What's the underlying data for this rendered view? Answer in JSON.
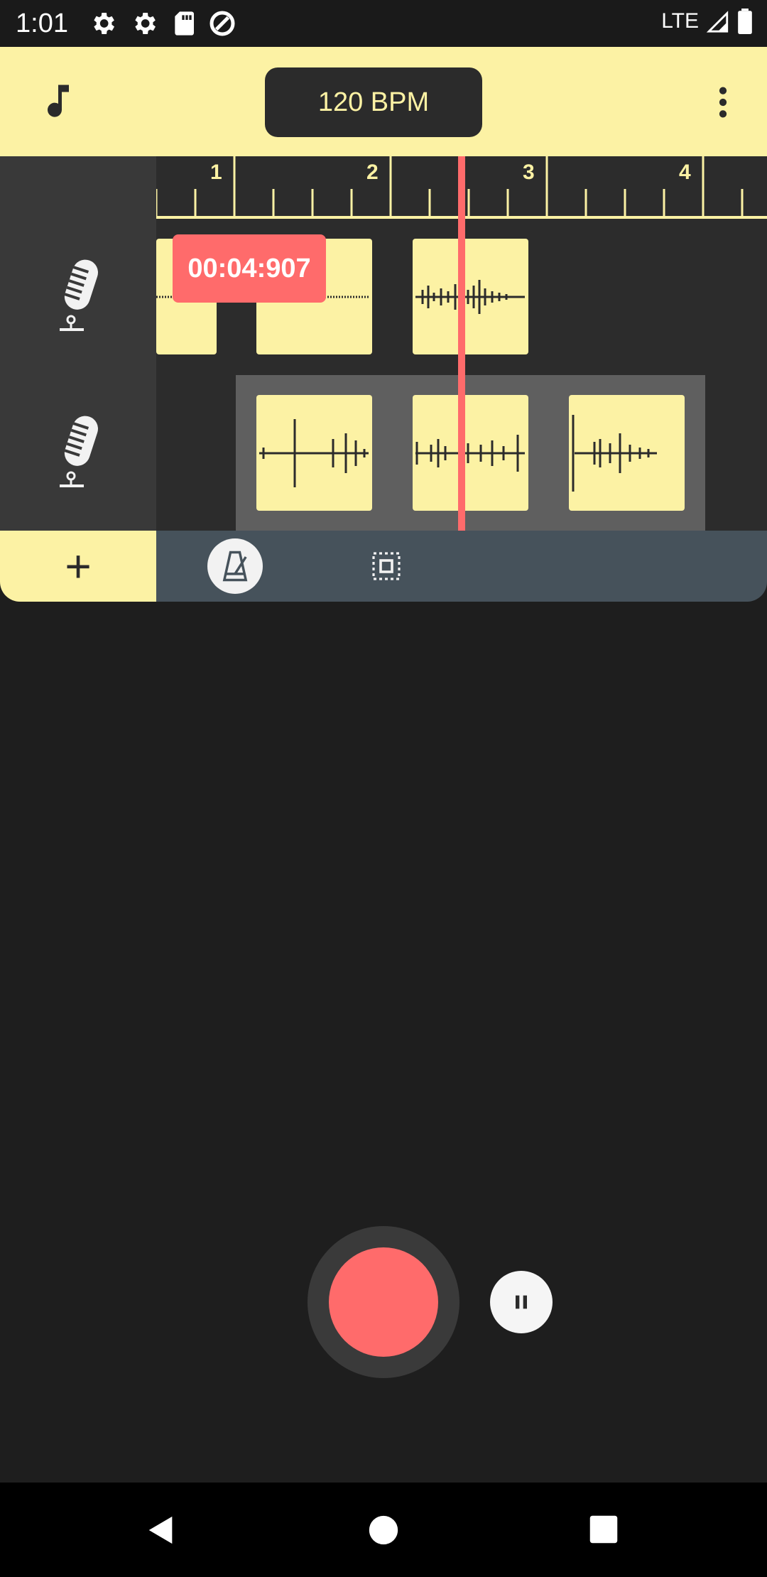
{
  "status_bar": {
    "time": "1:01",
    "network": "LTE",
    "icons": [
      "settings-icon",
      "settings-icon",
      "sd-card-icon",
      "data-saver-icon",
      "signal-icon",
      "battery-icon"
    ]
  },
  "toolbar": {
    "bpm_label": "120 BPM",
    "left_icon": "music-note-icon",
    "right_icon": "more-vert-icon"
  },
  "ruler": {
    "bars": [
      "1",
      "2",
      "3",
      "4"
    ]
  },
  "playback": {
    "time_label": "00:04:907"
  },
  "tracks": [
    {
      "icon": "microphone-icon"
    },
    {
      "icon": "microphone-icon"
    }
  ],
  "bottom_tools": {
    "add_label": "+",
    "metronome_icon": "metronome-icon",
    "select_icon": "select-all-icon"
  },
  "colors": {
    "accent_yellow": "#fcf2a4",
    "record_red": "#ff6b6b",
    "tools_bar": "#46525b"
  }
}
